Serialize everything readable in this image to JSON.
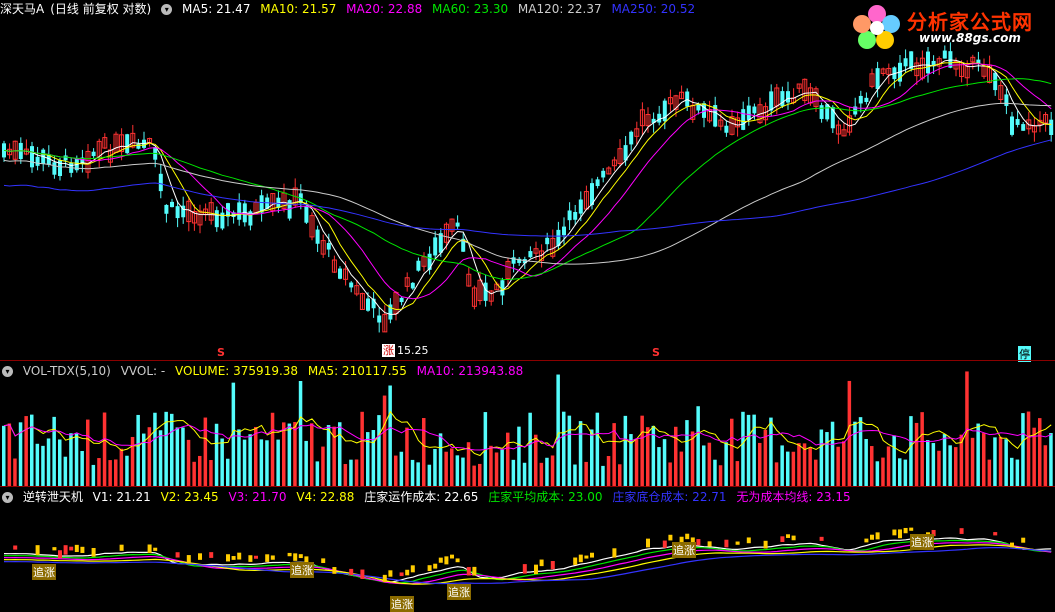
{
  "price_panel": {
    "title": "深天马A",
    "mode": "(日线 前复权 对数)",
    "ma5": "MA5: 21.47",
    "ma10": "MA10: 21.57",
    "ma20": "MA20: 22.88",
    "ma60": "MA60: 23.30",
    "ma120": "MA120: 22.37",
    "ma250": "MA250: 20.52",
    "low_label": "15.25",
    "zhang_label": "涨",
    "s_marker": "S",
    "ting_label": "停"
  },
  "volume_panel": {
    "name": "VOL-TDX(5,10)",
    "vvol": "VVOL: -",
    "volume": "VOLUME: 375919.38",
    "ma5": "MA5: 210117.55",
    "ma10": "MA10: 213943.88"
  },
  "indicator_panel": {
    "name": "逆转泄天机",
    "v1": "V1: 21.21",
    "v2": "V2: 23.45",
    "v3": "V3: 21.70",
    "v4": "V4: 22.88",
    "cost1": "庄家运作成本: 22.65",
    "cost2": "庄家平均成本: 23.00",
    "cost3": "庄家底仓成本: 22.71",
    "cost4": "无为成本均线: 23.15",
    "signal_label": "追涨"
  },
  "watermark": {
    "site_name": "分析家公式网",
    "url": "www.88gs.com"
  },
  "colors": {
    "up": "#ff3232",
    "down": "#54fcfc",
    "ma5": "#ffffff",
    "ma10": "#ffff00",
    "ma20": "#ff00ff",
    "ma60": "#00e600",
    "ma120": "#cccccc",
    "ma250": "#3333ff"
  }
}
